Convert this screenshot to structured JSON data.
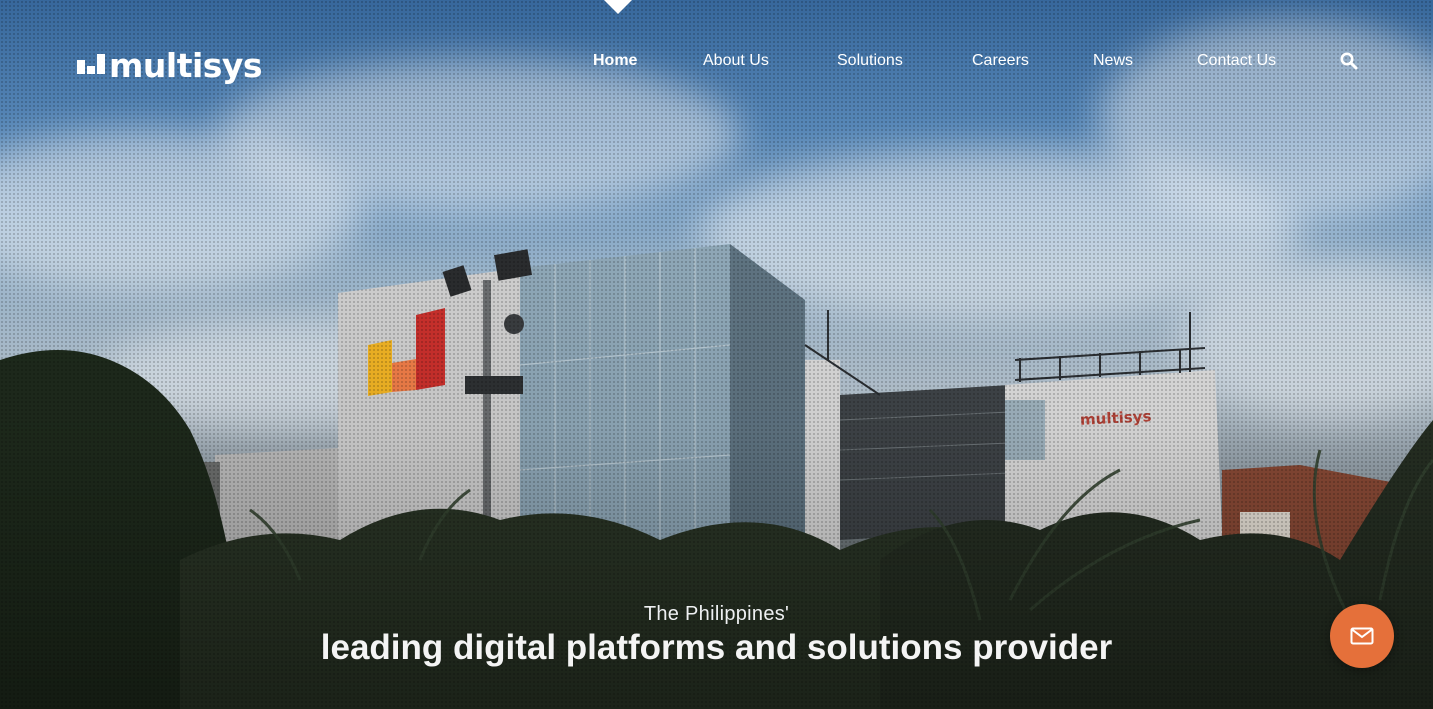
{
  "brand": {
    "logo_text": "multisys",
    "logo_mark_colors": [
      "#f0b324",
      "#ef7d48",
      "#c9302c"
    ]
  },
  "nav": {
    "items": [
      {
        "label": "Home",
        "active": true
      },
      {
        "label": "About Us",
        "active": false
      },
      {
        "label": "Solutions",
        "active": false
      },
      {
        "label": "Careers",
        "active": false
      },
      {
        "label": "News",
        "active": false
      },
      {
        "label": "Contact Us",
        "active": false
      }
    ],
    "search_icon": "search-icon"
  },
  "hero": {
    "tagline": "The Philippines'",
    "headline": "leading digital platforms and solutions provider",
    "building_sign": "multisys"
  },
  "contact_button": {
    "icon": "mail-icon",
    "color": "#e5703a"
  }
}
